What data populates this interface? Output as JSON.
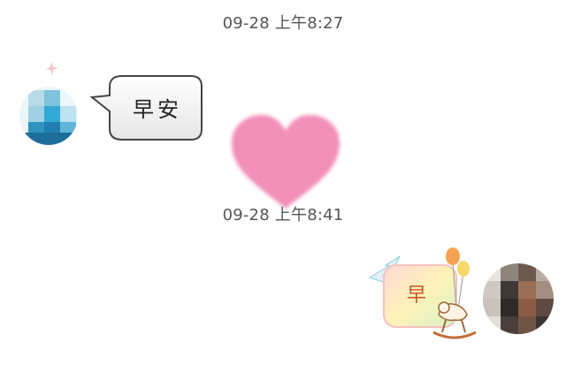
{
  "chat": {
    "timestamps": [
      "09-28 上午8:27",
      "09-28 上午8:41"
    ],
    "messages": [
      {
        "side": "left",
        "type": "text-bubble",
        "text": "早安"
      },
      {
        "side": "left",
        "type": "sticker",
        "sticker": "pink-heart"
      },
      {
        "side": "right",
        "type": "sticker",
        "sticker": "rocking-horse-balloon",
        "text": "早"
      }
    ]
  },
  "colors": {
    "timestamp_text": "#555555",
    "heart": "#f28fb9",
    "bubble_border": "#444444",
    "sticker_pastel": "#fbe3a6"
  }
}
